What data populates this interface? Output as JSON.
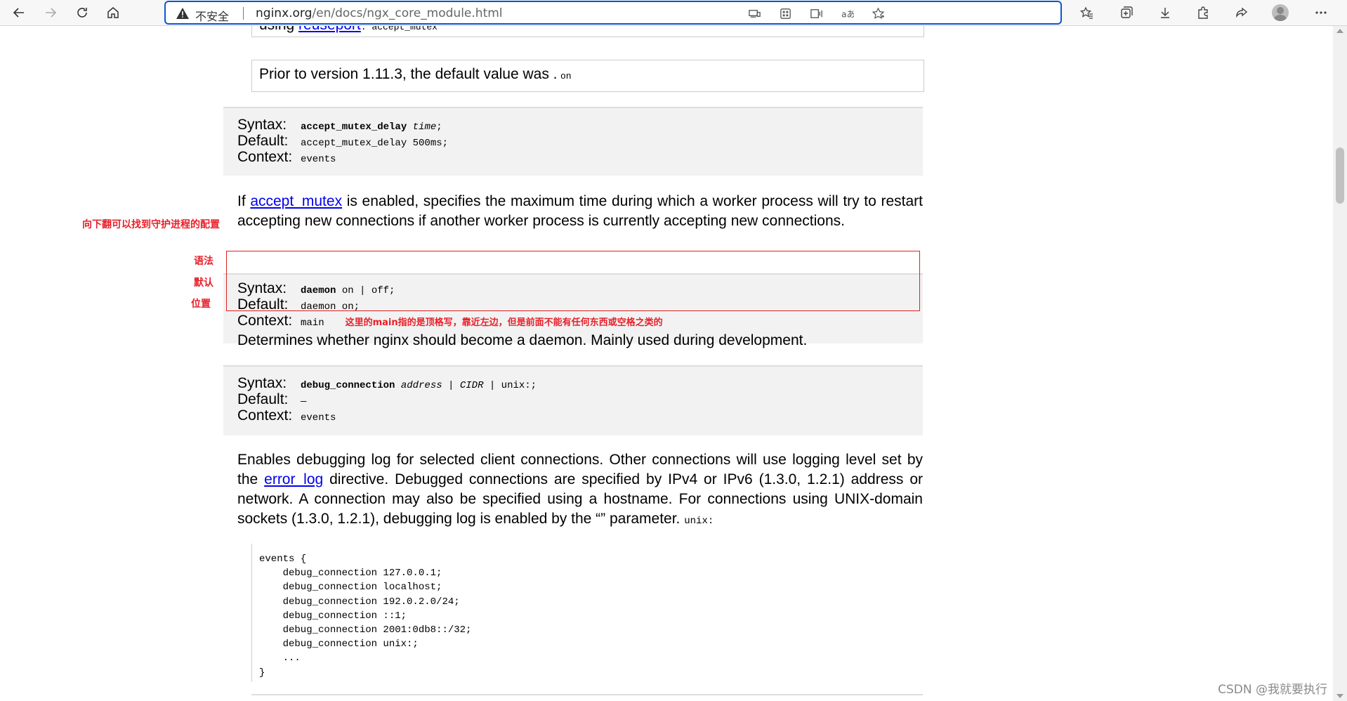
{
  "browser": {
    "insecure_label": "不安全",
    "url_host": "nginx.org",
    "url_path": "/en/docs/ngx_core_module.html"
  },
  "page": {
    "partial_top_text": "using",
    "partial_top_link": "reuseport",
    "partial_top_code": ". accept_mutex",
    "note_text": "Prior to version 1.11.3, the default value was .",
    "note_code": "on",
    "directive1": {
      "syntax_label": "Syntax:",
      "syntax_name": "accept_mutex_delay",
      "syntax_arg": "time",
      "syntax_end": ";",
      "default_label": "Default:",
      "default_value": "accept_mutex_delay 500ms;",
      "context_label": "Context:",
      "context_value": "events"
    },
    "para1_pre": "If",
    "para1_link": "accept_mutex",
    "para1_post": "is enabled, specifies the maximum time during which a worker process will try to restart accepting new connections if another worker process is currently accepting new connections.",
    "directive2": {
      "syntax_label": "Syntax:",
      "syntax_name": "daemon",
      "syntax_rest": "on | off;",
      "default_label": "Default:",
      "default_value": "daemon on;",
      "context_label": "Context:",
      "context_value": "main"
    },
    "para2": "Determines whether nginx should become a daemon. Mainly used during development.",
    "directive3": {
      "syntax_label": "Syntax:",
      "syntax_name": "debug_connection",
      "syntax_arg1": "address",
      "syntax_sep": " | ",
      "syntax_arg2": "CIDR",
      "syntax_rest": " | unix:;",
      "default_label": "Default:",
      "default_value": "—",
      "context_label": "Context:",
      "context_value": "events"
    },
    "para3_a": "Enables debugging log for selected client connections. Other connections will use logging level set by the",
    "para3_link": "error_log",
    "para3_b": "directive. Debugged connections are specified by IPv4 or IPv6 (1.3.0, 1.2.1) address or network. A connection may also be specified using a hostname. For connections using UNIX-domain sockets (1.3.0, 1.2.1), debugging log is enabled by the  “”  parameter.",
    "para3_code": "unix:",
    "code_block": "events {\n    debug_connection 127.0.0.1;\n    debug_connection localhost;\n    debug_connection 192.0.2.0/24;\n    debug_connection ::1;\n    debug_connection 2001:0db8::/32;\n    debug_connection unix:;\n    ...\n}"
  },
  "annotations": {
    "scroll_hint": "向下翻可以找到守护进程的配置",
    "syntax_cn": "语法",
    "default_cn": "默认",
    "context_cn": "位置",
    "main_note": "这里的main指的是顶格写，靠近左边，但是前面不能有任何东西或空格之类的"
  },
  "watermark": "CSDN @我就要执行",
  "colors": {
    "annotation_red": "#e8202a",
    "link_blue": "#0000ee",
    "address_border": "#0b57d0"
  },
  "icons": [
    "back-arrow-icon",
    "forward-arrow-icon",
    "refresh-icon",
    "home-icon",
    "warning-icon",
    "device-icon",
    "apps-icon",
    "read-aloud-icon",
    "translate-icon",
    "add-favorite-icon",
    "favorites-icon",
    "collections-icon",
    "download-icon",
    "extensions-icon",
    "share-icon",
    "profile-avatar",
    "more-icon"
  ]
}
